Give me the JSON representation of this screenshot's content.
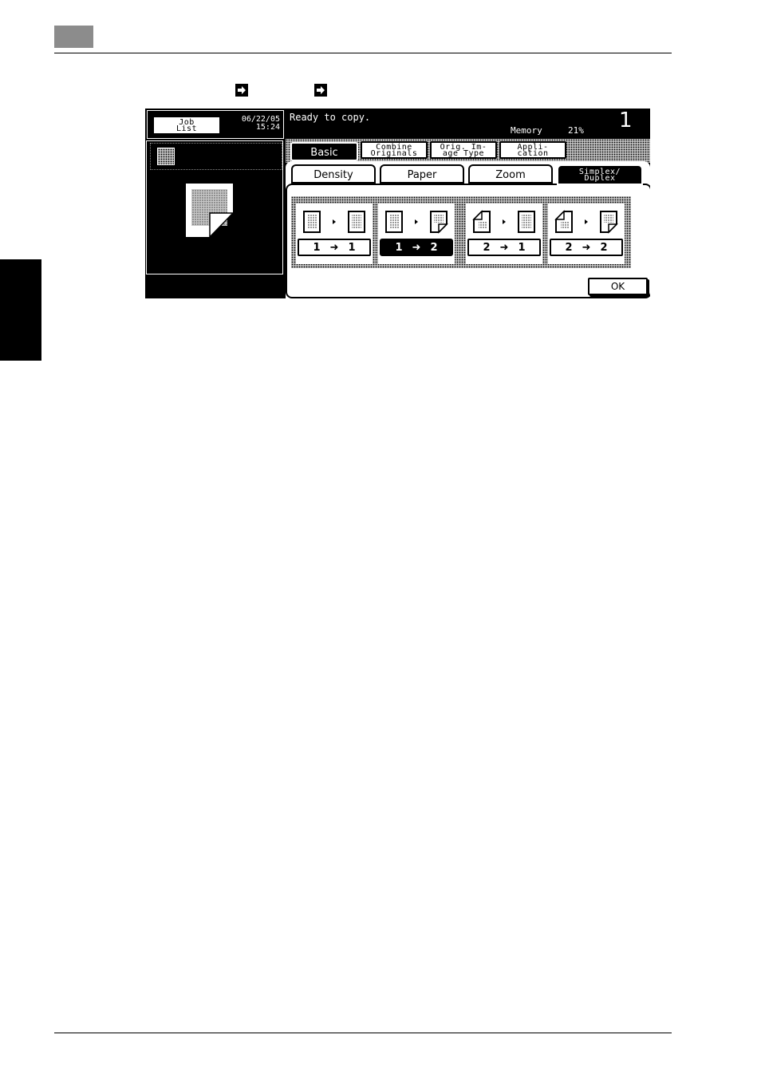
{
  "panel": {
    "job_list_label_line1": "Job",
    "job_list_label_line2": "List",
    "date": "06/22/05",
    "time": "15:24",
    "status_message": "Ready to copy.",
    "memory_label": "Memory",
    "memory_value": "21%",
    "copy_count": "1",
    "tabs_main": [
      {
        "label_line1": "Basic",
        "label_line2": ""
      },
      {
        "label_line1": "Combine",
        "label_line2": "Originals"
      },
      {
        "label_line1": "Orig. Im-",
        "label_line2": "age Type"
      },
      {
        "label_line1": "Appli-",
        "label_line2": "cation"
      }
    ],
    "tabs_sub": [
      {
        "label_line1": "Density",
        "label_line2": ""
      },
      {
        "label_line1": "Paper",
        "label_line2": ""
      },
      {
        "label_line1": "Zoom",
        "label_line2": ""
      },
      {
        "label_line1": "Simplex/",
        "label_line2": "Duplex"
      }
    ],
    "duplex_options": [
      {
        "from": "1",
        "to": "1",
        "selected": false
      },
      {
        "from": "1",
        "to": "2",
        "selected": true
      },
      {
        "from": "2",
        "to": "1",
        "selected": false
      },
      {
        "from": "2",
        "to": "2",
        "selected": false
      }
    ],
    "ok_label": "OK"
  }
}
